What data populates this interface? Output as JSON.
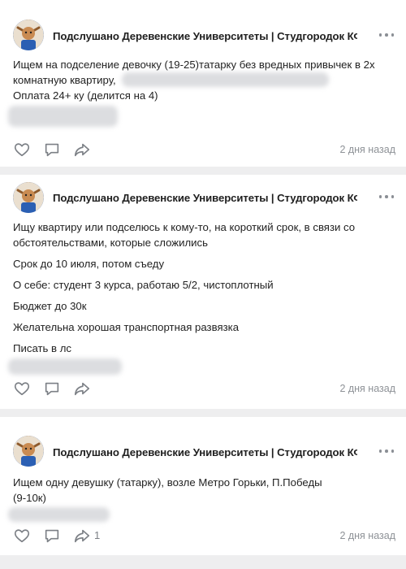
{
  "posts": [
    {
      "author": "Подслушано Деревенские Университеты | Студгородок КФУ",
      "lines": [
        "Ищем на подселение девочку (19-25)татарку без вредных привычек в 2х",
        "комнатную квартиру,",
        "Оплата 24+ ку (делится на 4)"
      ],
      "time": "2 дня назад",
      "share_count": ""
    },
    {
      "author": "Подслушано Деревенские Университеты | Студгородок КФУ",
      "lines": [
        "Ищу квартиру или подселюсь к кому-то, на короткий срок, в связи со",
        "обстоятельствами, которые сложились",
        "Срок до 10 июля, потом съеду",
        "О себе: студент 3 курса, работаю 5/2, чистоплотный",
        "Бюджет до 30к",
        "Желательна хорошая транспортная развязка",
        "Писать в лс"
      ],
      "time": "2 дня назад",
      "share_count": ""
    },
    {
      "author": "Подслушано Деревенские Университеты | Студгородок КФУ",
      "lines": [
        "Ищем одну девушку (татарку), возле Метро Горьки, П.Победы",
        "(9-10к)"
      ],
      "time": "2 дня назад",
      "share_count": "1"
    }
  ],
  "icons": {
    "like": "heart-icon",
    "comment": "comment-icon",
    "share": "share-icon",
    "more": "more-dots-icon"
  },
  "colors": {
    "text": "#222222",
    "meta": "#8e9297",
    "icon": "#7c8086",
    "divider": "#eeeeef"
  }
}
